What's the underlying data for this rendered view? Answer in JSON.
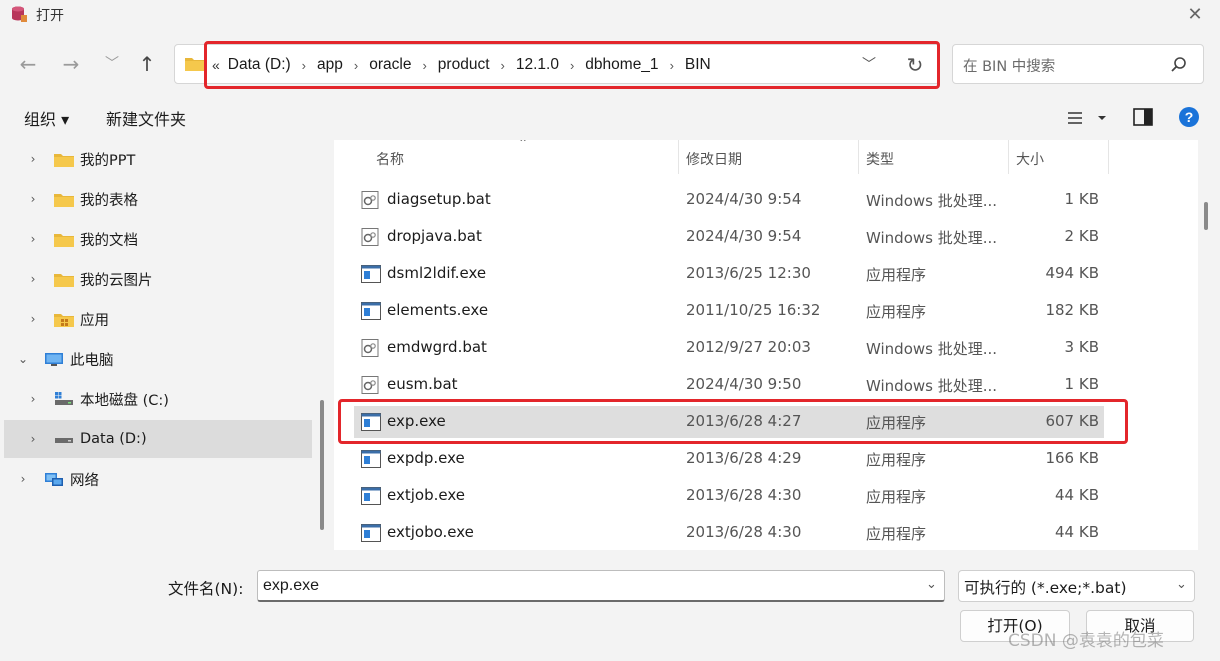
{
  "window": {
    "title": "打开"
  },
  "address": {
    "overflow": "«",
    "crumbs": [
      "Data (D:)",
      "app",
      "oracle",
      "product",
      "12.1.0",
      "dbhome_1",
      "BIN"
    ]
  },
  "search": {
    "placeholder": "在 BIN 中搜索"
  },
  "toolbar": {
    "organize": "组织 ▾",
    "new_folder": "新建文件夹"
  },
  "sidebar": {
    "items": [
      {
        "label": "我的PPT",
        "icon": "folder-icon",
        "expanded": false
      },
      {
        "label": "我的表格",
        "icon": "folder-icon",
        "expanded": false
      },
      {
        "label": "我的文档",
        "icon": "folder-icon",
        "expanded": false
      },
      {
        "label": "我的云图片",
        "icon": "folder-icon",
        "expanded": false
      },
      {
        "label": "应用",
        "icon": "apps-folder-icon",
        "expanded": false
      },
      {
        "label": "此电脑",
        "icon": "computer-icon",
        "expanded": true
      },
      {
        "label": "本地磁盘 (C:)",
        "icon": "drive-icon",
        "expanded": false
      },
      {
        "label": "Data (D:)",
        "icon": "drive-icon",
        "expanded": false,
        "selected": true
      },
      {
        "label": "网络",
        "icon": "network-icon",
        "expanded": false
      }
    ]
  },
  "columns": {
    "name": "名称",
    "date": "修改日期",
    "type": "类型",
    "size": "大小"
  },
  "files": [
    {
      "name": "diagsetup.bat",
      "date": "2024/4/30 9:54",
      "type": "Windows 批处理...",
      "size": "1 KB",
      "icon": "batch-file-icon"
    },
    {
      "name": "dropjava.bat",
      "date": "2024/4/30 9:54",
      "type": "Windows 批处理...",
      "size": "2 KB",
      "icon": "batch-file-icon"
    },
    {
      "name": "dsml2ldif.exe",
      "date": "2013/6/25 12:30",
      "type": "应用程序",
      "size": "494 KB",
      "icon": "exe-file-icon"
    },
    {
      "name": "elements.exe",
      "date": "2011/10/25 16:32",
      "type": "应用程序",
      "size": "182 KB",
      "icon": "exe-file-icon"
    },
    {
      "name": "emdwgrd.bat",
      "date": "2012/9/27 20:03",
      "type": "Windows 批处理...",
      "size": "3 KB",
      "icon": "batch-file-icon"
    },
    {
      "name": "eusm.bat",
      "date": "2024/4/30 9:50",
      "type": "Windows 批处理...",
      "size": "1 KB",
      "icon": "batch-file-icon"
    },
    {
      "name": "exp.exe",
      "date": "2013/6/28 4:27",
      "type": "应用程序",
      "size": "607 KB",
      "icon": "exe-file-icon",
      "selected": true
    },
    {
      "name": "expdp.exe",
      "date": "2013/6/28 4:29",
      "type": "应用程序",
      "size": "166 KB",
      "icon": "exe-file-icon"
    },
    {
      "name": "extjob.exe",
      "date": "2013/6/28 4:30",
      "type": "应用程序",
      "size": "44 KB",
      "icon": "exe-file-icon"
    },
    {
      "name": "extjobo.exe",
      "date": "2013/6/28 4:30",
      "type": "应用程序",
      "size": "44 KB",
      "icon": "exe-file-icon"
    }
  ],
  "bottom": {
    "filename_label": "文件名(N):",
    "filename_value": "exp.exe",
    "filetype_value": "可执行的 (*.exe;*.bat)",
    "open_label": "打开(O)",
    "cancel_label": "取消"
  },
  "watermark": "CSDN @袁袁的包菜",
  "colors": {
    "highlight": "#e3262b",
    "selected_row": "#dedede",
    "help": "#1a73d9"
  }
}
